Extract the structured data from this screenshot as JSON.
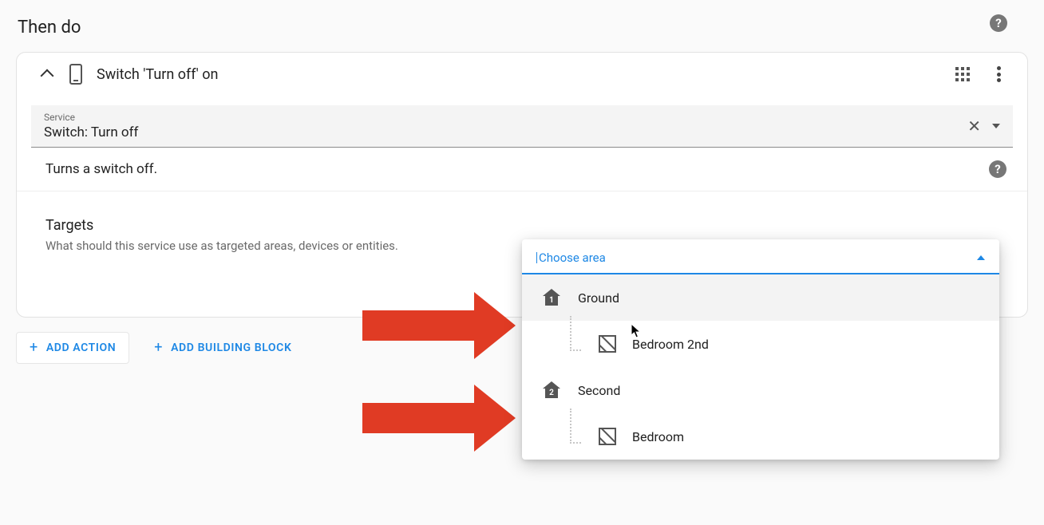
{
  "section": {
    "title": "Then do"
  },
  "card": {
    "header_title": "Switch 'Turn off' on",
    "service": {
      "label": "Service",
      "value": "Switch: Turn off"
    },
    "description": "Turns a switch off.",
    "targets": {
      "title": "Targets",
      "description": "What should this service use as targeted areas, devices or entities."
    }
  },
  "buttons": {
    "add_action": "Add Action",
    "add_building_block": "Add Building Block"
  },
  "area_picker": {
    "label": "Choose area",
    "floors": [
      {
        "name": "Ground",
        "num": "1",
        "rooms": [
          {
            "name": "Bedroom 2nd"
          }
        ]
      },
      {
        "name": "Second",
        "num": "2",
        "rooms": [
          {
            "name": "Bedroom"
          }
        ]
      }
    ]
  }
}
